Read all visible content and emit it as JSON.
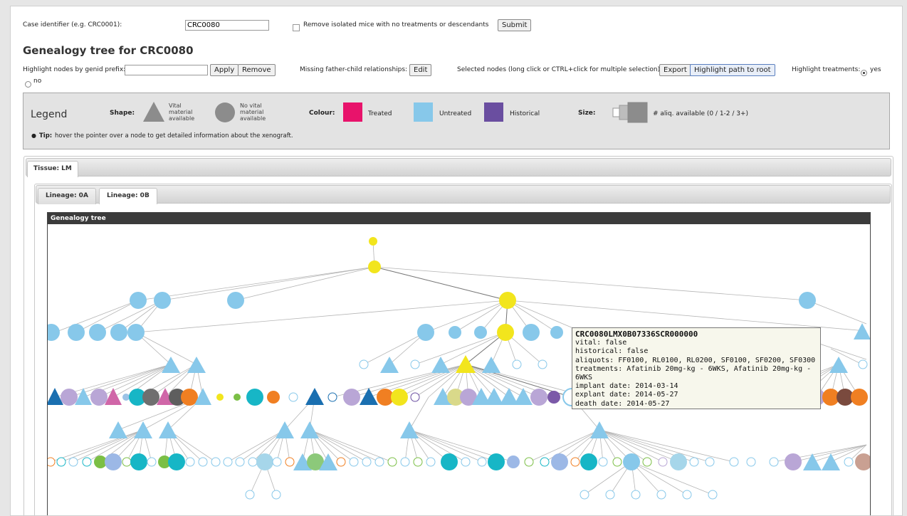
{
  "form": {
    "case_label": "Case identifier (e.g. CRC0001):",
    "case_value": "CRC0080",
    "remove_isolated_label": "Remove isolated mice with no treatments or descendants",
    "submit_label": "Submit"
  },
  "title": "Genealogy tree for CRC0080",
  "controls": {
    "highlight_prefix_label": "Highlight nodes by genid prefix:",
    "highlight_prefix_value": "",
    "apply_label": "Apply",
    "remove_label": "Remove",
    "missing_rel_label": "Missing father-child relationships:",
    "edit_label": "Edit",
    "selected_nodes_label": "Selected nodes (long click or CTRL+click for multiple selection):",
    "export_label": "Export",
    "highlight_path_label": "Highlight path to root",
    "highlight_treatments_label": "Highlight treatments:",
    "yes_label": "yes",
    "no_label": "no"
  },
  "legend": {
    "title": "Legend",
    "shape_label": "Shape:",
    "vital_text": "Vital material available",
    "no_vital_text": "No vital material available",
    "colour_label": "Colour:",
    "treated": "Treated",
    "untreated": "Untreated",
    "historical": "Historical",
    "size_label": "Size:",
    "size_text": "# aliq. available (0 / 1-2 / 3+)",
    "tip_bold": "Tip:",
    "tip_text": "hover the pointer over a node to get detailed information about the xenograft.",
    "colors": {
      "treated": "#e8136b",
      "untreated": "#87c8ea",
      "historical": "#6a4ea0"
    }
  },
  "tabs": {
    "tissue": "Tissue: LM",
    "lineage_a": "Lineage: 0A",
    "lineage_b": "Lineage: 0B"
  },
  "chart": {
    "header": "Genealogy tree"
  },
  "tooltip": {
    "id": "CRC0080LMX0B07336SCR000000",
    "vital": "vital: false",
    "historical": "historical: false",
    "aliquots": "aliquots: FF0100, RL0100, RL0200, SF0100, SF0200, SF0300",
    "treatments": "treatments: Afatinib 20mg-kg - 6WKS, Afatinib 20mg-kg - 6WKS",
    "implant": "implant date: 2014-03-14",
    "explant": "explant date: 2014-05-27",
    "death": "death date: 2014-05-27"
  }
}
